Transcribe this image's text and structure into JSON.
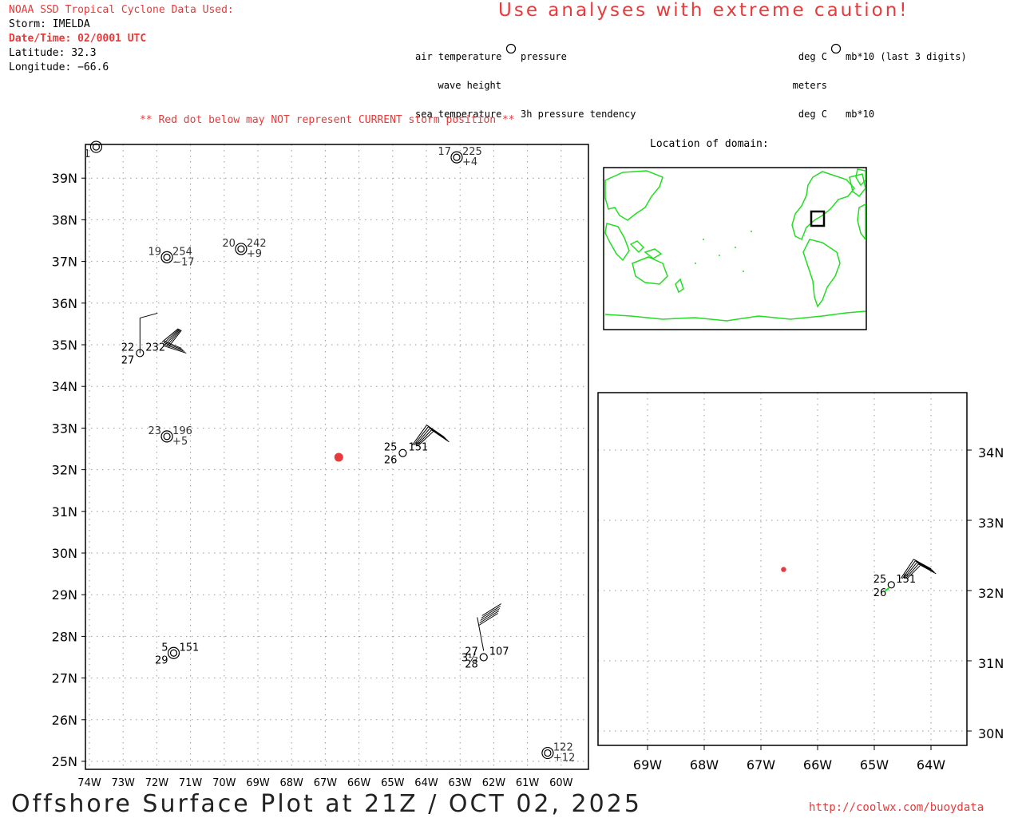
{
  "header": {
    "source_title": "NOAA SSD Tropical Cyclone Data Used:",
    "storm": "Storm: IMELDA",
    "datetime": "Date/Time: 02/0001 UTC",
    "latitude": "Latitude: 32.3",
    "longitude": "Longitude: −66.6",
    "caution": "Use analyses with extreme caution!"
  },
  "legend_left": {
    "air_temp": "air temperature",
    "wave_height": "wave height",
    "sea_temp": "sea temperature",
    "pressure": "pressure",
    "tendency": "3h pressure tendency"
  },
  "legend_right": {
    "air_unit": "deg C",
    "wave_unit": "meters",
    "sea_unit": "deg C",
    "pressure_unit": "mb*10 (last 3 digits)",
    "tendency_unit": "mb*10"
  },
  "warning": "** Red dot below may NOT represent CURRENT storm position **",
  "inset_title": "Location of domain:",
  "footer": {
    "title": "Offshore Surface Plot at 21Z / OCT 02, 2025",
    "url": "http://coolwx.com/buoydata"
  },
  "main_map": {
    "lat_labels": [
      "25N",
      "26N",
      "27N",
      "28N",
      "29N",
      "30N",
      "31N",
      "32N",
      "33N",
      "34N",
      "35N",
      "36N",
      "37N",
      "38N",
      "39N"
    ],
    "lon_labels": [
      "74W",
      "73W",
      "72W",
      "71W",
      "70W",
      "69W",
      "68W",
      "67W",
      "66W",
      "65W",
      "64W",
      "63W",
      "62W",
      "61W",
      "60W"
    ],
    "storm": {
      "lat": 32.3,
      "lon": -66.6
    },
    "stations": [
      {
        "lat": 39.75,
        "lon": -73.8,
        "type": "buoy",
        "air": "",
        "pressure": "",
        "tendency": "",
        "sea": "1",
        "wave": ""
      },
      {
        "lat": 39.5,
        "lon": -63.1,
        "type": "buoy",
        "air": "17",
        "pressure": "225",
        "tendency": "+4",
        "sea": "",
        "wave": ""
      },
      {
        "lat": 37.1,
        "lon": -71.7,
        "type": "buoy",
        "air": "19",
        "pressure": "254",
        "tendency": "−17",
        "sea": "",
        "wave": ""
      },
      {
        "lat": 37.3,
        "lon": -69.5,
        "type": "buoy",
        "air": "20",
        "pressure": "242",
        "tendency": "+9",
        "sea": "",
        "wave": ""
      },
      {
        "lat": 34.8,
        "lon": -72.5,
        "type": "ship",
        "air": "22",
        "pressure": "232",
        "tendency": "",
        "sea": "27",
        "wave": ""
      },
      {
        "lat": 32.8,
        "lon": -71.7,
        "type": "buoy",
        "air": "23",
        "pressure": "196",
        "tendency": "+5",
        "sea": "",
        "wave": ""
      },
      {
        "lat": 32.4,
        "lon": -64.7,
        "type": "ship",
        "air": "25",
        "pressure": "151",
        "tendency": "",
        "sea": "26",
        "wave": ""
      },
      {
        "lat": 27.6,
        "lon": -71.5,
        "type": "buoy-bold",
        "air": "5",
        "pressure": "151",
        "tendency": "",
        "sea": "29",
        "wave": ""
      },
      {
        "lat": 27.5,
        "lon": -62.3,
        "type": "ship",
        "air": "27",
        "pressure": "107",
        "tendency": "",
        "sea": "28",
        "wave": "3½"
      },
      {
        "lat": 25.2,
        "lon": -60.4,
        "type": "buoy",
        "air": "",
        "pressure": "122",
        "tendency": "+12",
        "sea": "",
        "wave": ""
      }
    ]
  },
  "zoom_map": {
    "lat_labels": [
      "30N",
      "31N",
      "32N",
      "33N",
      "34N"
    ],
    "lon_labels": [
      "69W",
      "68W",
      "67W",
      "66W",
      "65W",
      "64W"
    ],
    "storm": {
      "lat": 32.3,
      "lon": -66.6
    },
    "station": {
      "lat": 32.4,
      "lon": -64.7,
      "air": "25",
      "pressure": "151",
      "sea": "26"
    }
  },
  "colors": {
    "storm_dot": "#e83a3a",
    "coastline": "#22dd22",
    "header_red": "#e83a3a",
    "grid": "#9a9a9a"
  }
}
